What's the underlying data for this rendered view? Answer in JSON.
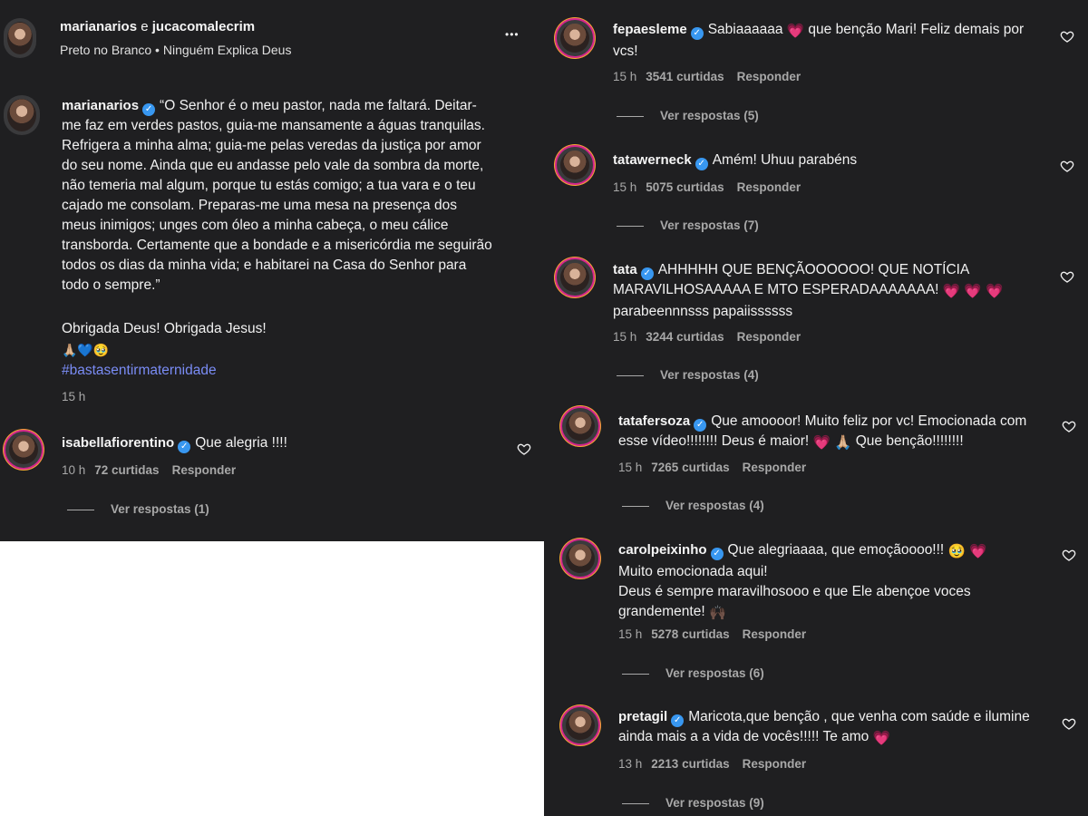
{
  "post": {
    "header_users": "marianarios",
    "header_and": "e",
    "header_second": "jucacomalecrim",
    "audio": "Preto no Branco • Ninguém Explica Deus",
    "more_glyph": "•••",
    "author": "marianarios",
    "caption": "“O Senhor é o meu pastor, nada me faltará. Deitar-me faz em verdes pastos, guia-me mansamente a águas tranquilas. Refrigera a minha alma; guia-me pelas veredas da justiça por amor do seu nome. Ainda que eu andasse pelo vale da sombra da morte, não temeria mal algum, porque tu estás comigo; a tua vara e o teu cajado me consolam. Preparas-me uma mesa na presença dos meus inimigos; unges com óleo a minha cabeça, o meu cálice transborda. Certamente que a bondade e a misericórdia me seguirão todos os dias da minha vida; e habitarei na Casa do Senhor para todo o sempre.”",
    "thanks": "Obrigada Deus! Obrigada Jesus!",
    "emojis": "🙏🏼💙🥹",
    "hashtag": "#bastasentirmaternidade",
    "time": "15 h"
  },
  "comments": [
    {
      "user": "isabellafiorentino",
      "text": "Que alegria !!!!",
      "time": "10 h",
      "likes": "72 curtidas",
      "reply": "Responder",
      "replies": "Ver respostas (1)"
    },
    {
      "user": "fepaesleme",
      "text_a": "Sabiaaaaaa",
      "emoji": "💗",
      "text_b": "que benção Mari! Feliz demais por vcs!",
      "time": "15 h",
      "likes": "3541 curtidas",
      "reply": "Responder",
      "replies": "Ver respostas (5)"
    },
    {
      "user": "tatawerneck",
      "text": "Amém! Uhuu parabéns",
      "time": "15 h",
      "likes": "5075 curtidas",
      "reply": "Responder",
      "replies": "Ver respostas (7)"
    },
    {
      "user": "tata",
      "text_a": "AHHHHH QUE BENÇÃOOOOOO! QUE NOTÍCIA MARAVILHOSAAAAA E MTO ESPERADAAAAAAA!",
      "emoji": "💗 💗 💗",
      "text_b": "parabeennnsss papaiissssss",
      "time": "15 h",
      "likes": "3244 curtidas",
      "reply": "Responder",
      "replies": "Ver respostas (4)"
    },
    {
      "user": "tatafersoza",
      "text_a": "Que amoooor! Muito feliz por vc! Emocionada com esse vídeo!!!!!!!! Deus é maior!",
      "emoji": "💗 🙏🏼",
      "text_b": "Que benção!!!!!!!!",
      "time": "15 h",
      "likes": "7265 curtidas",
      "reply": "Responder",
      "replies": "Ver respostas (4)"
    },
    {
      "user": "carolpeixinho",
      "text_a": "Que alegriaaaa, que emoçãoooo!!!",
      "emoji": "🥹 💗",
      "text_b": "Muito emocionada aqui!",
      "text_c": "Deus é sempre maravilhosooo e que Ele abençoe voces grandemente!",
      "emoji2": "🙌🏿",
      "time": "15 h",
      "likes": "5278 curtidas",
      "reply": "Responder",
      "replies": "Ver respostas (6)"
    },
    {
      "user": "pretagil",
      "text_a": "Maricota,que benção , que venha com saúde e ilumine ainda mais a a vida de vocês!!!!! Te amo",
      "emoji": "💗",
      "time": "13 h",
      "likes": "2213 curtidas",
      "reply": "Responder",
      "replies": "Ver respostas (9)"
    }
  ],
  "colors": {
    "background": "#1f1f21",
    "verified": "#3897f0",
    "hashtag": "#7a8cf5",
    "meta": "#a8a8a8",
    "ring": "#d2268c"
  },
  "icons": {
    "verified": "verified-badge-icon",
    "like": "heart-outline-icon",
    "more": "more-options-icon"
  }
}
